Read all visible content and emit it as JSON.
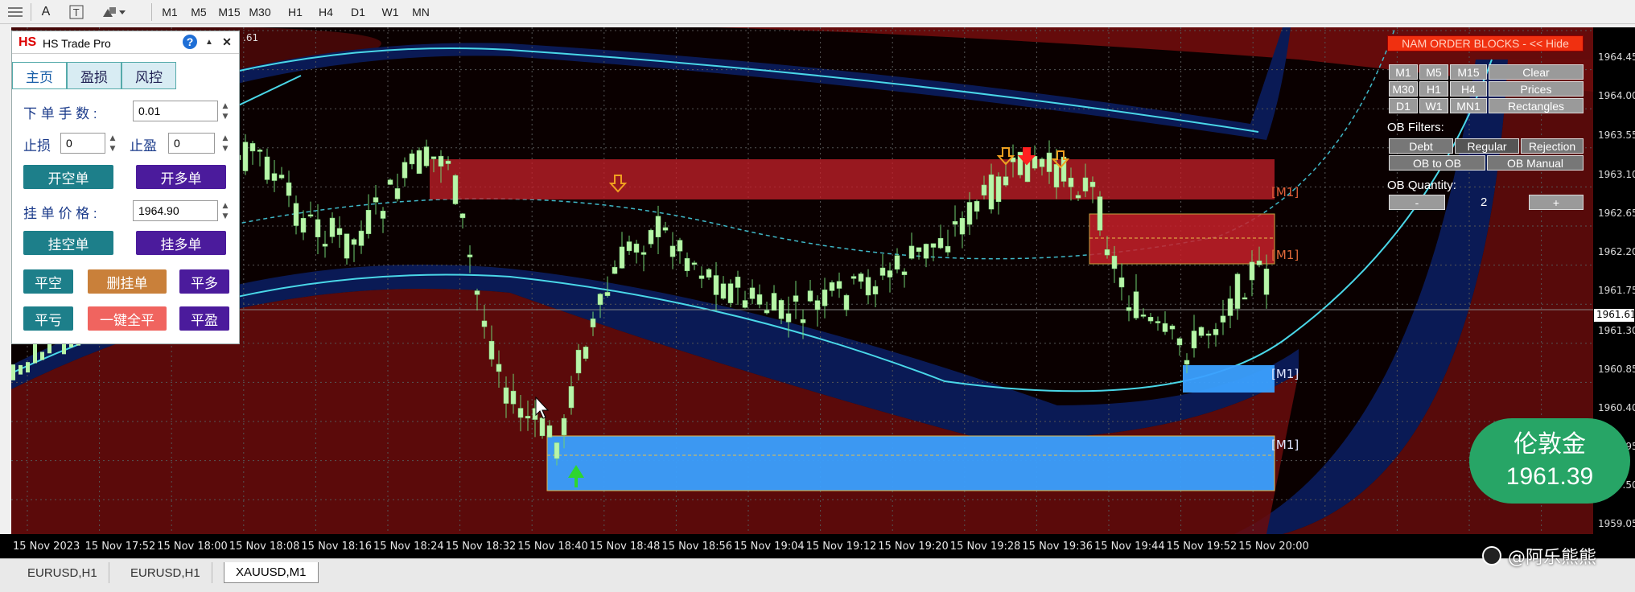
{
  "toolbar": {
    "icons": [
      "list-icon",
      "text-icon",
      "text-box-icon",
      "shapes-icon"
    ],
    "timeframes": [
      "M1",
      "M5",
      "M15",
      "M30",
      "H1",
      "H4",
      "D1",
      "W1",
      "MN"
    ]
  },
  "chart": {
    "symbol_label": ".61",
    "price_ticks": [
      "1964.45",
      "1964.00",
      "1963.55",
      "1963.10",
      "1962.65",
      "1962.20",
      "1961.75",
      "1961.30",
      "1960.85",
      "1960.40",
      "1959.95",
      "1959.50",
      "1959.05"
    ],
    "current_price": "1961.61",
    "time_ticks": [
      "15 Nov 2023",
      "15 Nov 17:52",
      "15 Nov 18:00",
      "15 Nov 18:08",
      "15 Nov 18:16",
      "15 Nov 18:24",
      "15 Nov 18:32",
      "15 Nov 18:40",
      "15 Nov 18:48",
      "15 Nov 18:56",
      "15 Nov 19:04",
      "15 Nov 19:12",
      "15 Nov 19:20",
      "15 Nov 19:28",
      "15 Nov 19:36",
      "15 Nov 19:44",
      "15 Nov 19:52",
      "15 Nov 20:00"
    ],
    "block_labels": [
      "[M1]",
      "[M1]",
      "[M1]",
      "[M1]"
    ],
    "colors": {
      "bull_candle": "#b8f5a8",
      "bear_block": "#c8202a",
      "bull_block": "#3ba0ff",
      "band_red": "#6a0c0c",
      "band_blue": "#0a1a55",
      "cyan_line": "#4ad7e8"
    }
  },
  "trade_panel": {
    "logo": "HS",
    "title": "HS Trade Pro",
    "help": "?",
    "minimize": "▲",
    "close": "✕",
    "tabs": [
      "主页",
      "盈损",
      "风控"
    ],
    "lot_label": "下 单 手 数 :",
    "lot_value": "0.01",
    "sl_label": "止损",
    "sl_value": "0",
    "tp_label": "止盈",
    "tp_value": "0",
    "sell_market": "开空单",
    "buy_market": "开多单",
    "pending_price_label": "挂 单 价 格 :",
    "pending_price_value": "1964.90",
    "sell_pending": "挂空单",
    "buy_pending": "挂多单",
    "close_short": "平空",
    "delete_pending": "删挂单",
    "close_long": "平多",
    "close_loss": "平亏",
    "close_all": "一键全平",
    "close_profit": "平盈"
  },
  "order_blocks": {
    "header": "NAM ORDER BLOCKS - << Hide",
    "tf_row1": [
      "M1",
      "M5",
      "M15",
      "Clear"
    ],
    "tf_row2": [
      "M30",
      "H1",
      "H4",
      "Prices"
    ],
    "tf_row3": [
      "D1",
      "W1",
      "MN1",
      "Rectangles"
    ],
    "filters_label": "OB Filters:",
    "filter_row1": [
      "Debt",
      "Regular",
      "Rejection"
    ],
    "filter_row2": [
      "OB to OB",
      "OB Manual"
    ],
    "quantity_label": "OB Quantity:",
    "minus": "-",
    "quantity": "2",
    "plus": "+"
  },
  "badge": {
    "name": "伦敦金",
    "price": "1961.39"
  },
  "tabs": [
    "EURUSD,H1",
    "EURUSD,H1",
    "XAUUSD,M1"
  ],
  "watermark": "@阿乐熊熊"
}
